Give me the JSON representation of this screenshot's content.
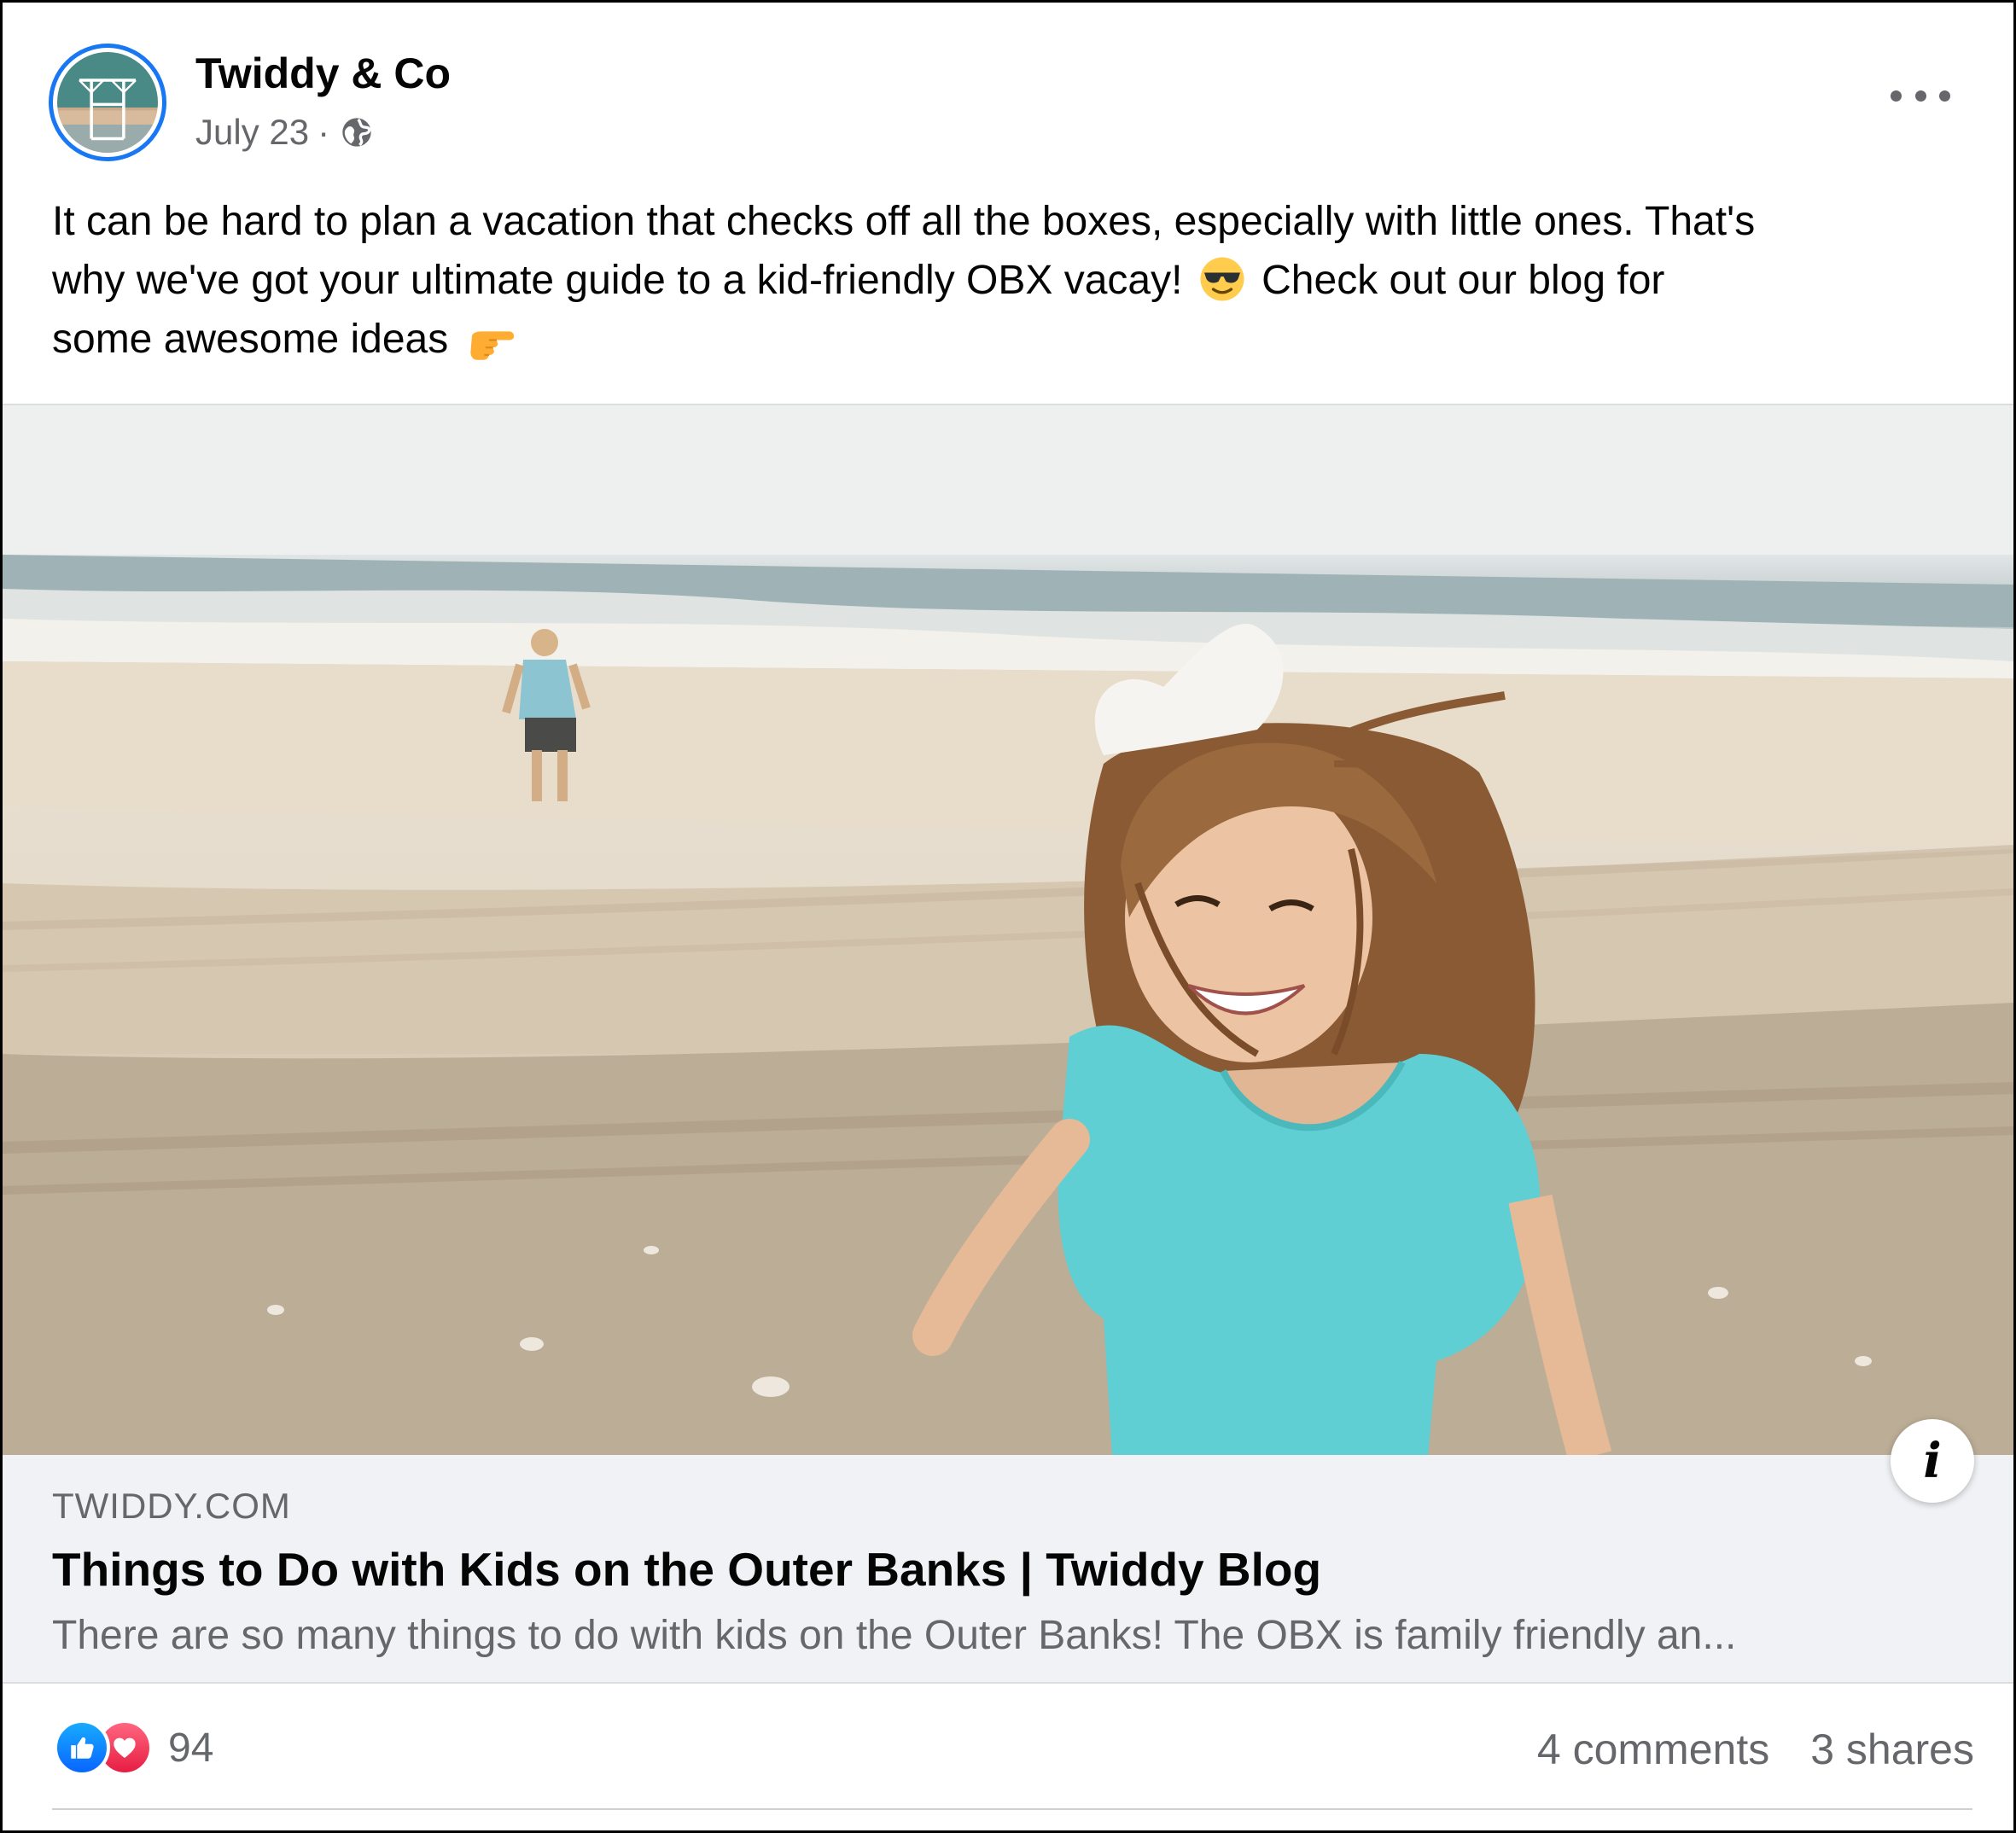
{
  "post": {
    "author": "Twiddy & Co",
    "date": "July 23",
    "separator": "·",
    "privacy_icon": "globe-icon",
    "more_icon": "more-options-icon",
    "caption_line1": "It can be hard to plan a vacation that checks off all the boxes, especially with little ones. That's",
    "caption_line2a": "why we've got your ultimate guide to a kid-friendly OBX vacay!",
    "caption_line2b": "Check out our blog for",
    "caption_line3": "some awesome ideas",
    "emoji_1": "smiling-face-with-sunglasses",
    "emoji_2": "backhand-index-pointing-right"
  },
  "link_preview": {
    "domain": "TWIDDY.COM",
    "title": "Things to Do with Kids on the Outer Banks | Twiddy Blog",
    "description": "There are so many things to do with kids on the Outer Banks! The OBX is family friendly an..."
  },
  "engagement": {
    "reaction_count": "94",
    "comments": "4 comments",
    "shares": "3 shares"
  },
  "colors": {
    "accent": "#1877f2",
    "like": "#0866ff",
    "love": "#e61e42",
    "secondary_text": "#65676b"
  }
}
